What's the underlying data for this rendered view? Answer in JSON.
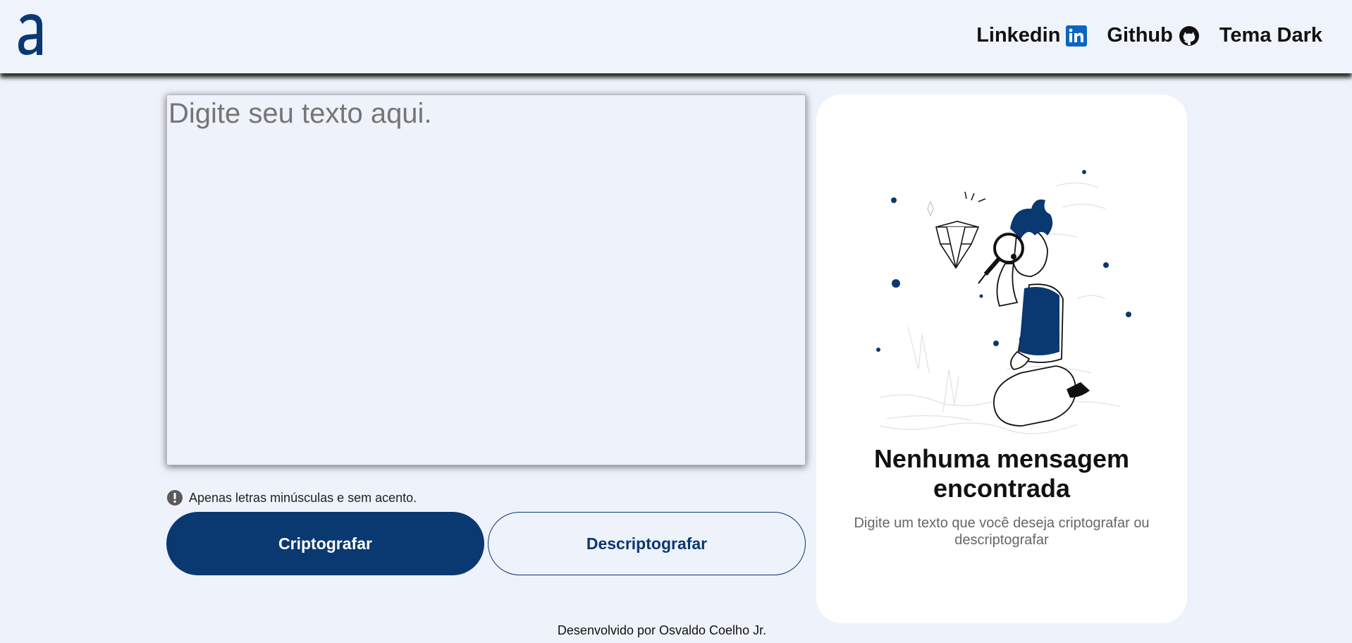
{
  "header": {
    "logo_icon": "alura-a-logo-icon",
    "nav": {
      "linkedin_label": "Linkedin",
      "github_label": "Github",
      "theme_label": "Tema Dark"
    }
  },
  "editor": {
    "placeholder": "Digite seu texto aqui.",
    "value": ""
  },
  "hint": {
    "icon": "exclamation-circle-icon",
    "text": "Apenas letras minúsculas e sem acento."
  },
  "actions": {
    "encrypt_label": "Criptografar",
    "decrypt_label": "Descriptografar"
  },
  "output_panel": {
    "illustration": "person-with-magnifier-illustration",
    "title": "Nenhuma mensagem encontrada",
    "subtitle": "Digite um texto que você deseja criptografar ou descriptografar"
  },
  "footer": {
    "credit": "Desenvolvido por Osvaldo Coelho Jr."
  },
  "colors": {
    "primary": "#0a3871",
    "background": "#eef2fa",
    "panel": "#ffffff",
    "linkedin": "#0a66c2"
  }
}
